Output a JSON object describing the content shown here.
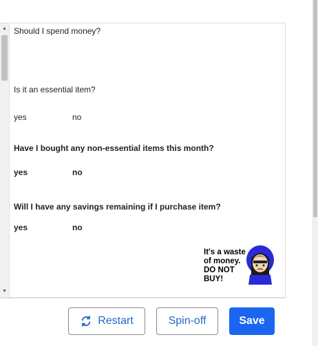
{
  "flow": {
    "question1": "Should I spend money?",
    "question2": "Is it an essential item?",
    "question2_yes": "yes",
    "question2_no": "no",
    "question3": "Have I bought any non-essential items this month?",
    "question3_yes": "yes",
    "question3_no": "no",
    "question4": "Will I have any savings remaining if I purchase item?",
    "question4_yes": "yes",
    "question4_no": "no",
    "result": {
      "line1": "It's a waste",
      "line2": "of money.",
      "line3": "DO NOT",
      "line4": "BUY!"
    }
  },
  "footer": {
    "restart_label": "Restart",
    "spinoff_label": "Spin-off",
    "save_label": "Save"
  },
  "colors": {
    "accent": "#2166c9",
    "save_bg": "#1a66f0",
    "avatar_hood": "#2b2bd6"
  }
}
